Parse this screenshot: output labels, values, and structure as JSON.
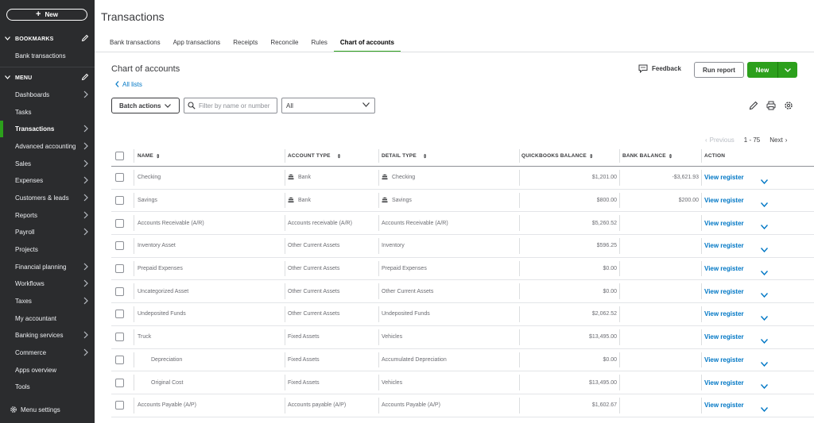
{
  "sidebar": {
    "new_label": "New",
    "bookmarks_label": "BOOKMARKS",
    "bookmark_items": [
      "Bank transactions"
    ],
    "menu_label": "MENU",
    "items": [
      {
        "label": "Dashboards",
        "arrow": true
      },
      {
        "label": "Tasks",
        "arrow": false
      },
      {
        "label": "Transactions",
        "arrow": true,
        "active": true
      },
      {
        "label": "Advanced accounting",
        "arrow": true
      },
      {
        "label": "Sales",
        "arrow": true
      },
      {
        "label": "Expenses",
        "arrow": true
      },
      {
        "label": "Customers & leads",
        "arrow": true
      },
      {
        "label": "Reports",
        "arrow": true
      },
      {
        "label": "Payroll",
        "arrow": true
      },
      {
        "label": "Projects",
        "arrow": false
      },
      {
        "label": "Financial planning",
        "arrow": true
      },
      {
        "label": "Workflows",
        "arrow": true
      },
      {
        "label": "Taxes",
        "arrow": true
      },
      {
        "label": "My accountant",
        "arrow": false
      },
      {
        "label": "Banking services",
        "arrow": true
      },
      {
        "label": "Commerce",
        "arrow": true
      },
      {
        "label": "Apps overview",
        "arrow": false
      },
      {
        "label": "Tools",
        "arrow": false
      }
    ],
    "settings_label": "Menu settings"
  },
  "header": {
    "title": "Transactions",
    "tabs": [
      "Bank transactions",
      "App transactions",
      "Receipts",
      "Reconcile",
      "Rules",
      "Chart of accounts"
    ],
    "active_tab": "Chart of accounts"
  },
  "content": {
    "title": "Chart of accounts",
    "back_link": "All lists",
    "feedback_label": "Feedback",
    "run_report_label": "Run report",
    "new_label": "New",
    "batch_actions_label": "Batch actions",
    "search_placeholder": "Filter by name or number",
    "filter_value": "All",
    "pager": {
      "previous": "Previous",
      "range": "1 - 75",
      "next": "Next"
    }
  },
  "colors": {
    "accent": "#2ca01c",
    "link": "#0077c5",
    "sidebar_bg": "#2b2c2e"
  },
  "table": {
    "headers": {
      "name": "NAME",
      "account_type": "ACCOUNT TYPE",
      "detail_type": "DETAIL TYPE",
      "qb_balance": "QUICKBOOKS BALANCE",
      "bank_balance": "BANK BALANCE",
      "action": "ACTION"
    },
    "action_label": "View register",
    "rows": [
      {
        "name": "Checking",
        "account_type": "Bank",
        "detail_type": "Checking",
        "qb_balance": "$1,201.00",
        "bank_balance": "-$3,621.93",
        "bank_icon": true,
        "indent": false
      },
      {
        "name": "Savings",
        "account_type": "Bank",
        "detail_type": "Savings",
        "qb_balance": "$800.00",
        "bank_balance": "$200.00",
        "bank_icon": true,
        "indent": false
      },
      {
        "name": "Accounts Receivable (A/R)",
        "account_type": "Accounts receivable (A/R)",
        "detail_type": "Accounts Receivable (A/R)",
        "qb_balance": "$5,260.52",
        "bank_balance": "",
        "bank_icon": false,
        "indent": false
      },
      {
        "name": "Inventory Asset",
        "account_type": "Other Current Assets",
        "detail_type": "Inventory",
        "qb_balance": "$596.25",
        "bank_balance": "",
        "bank_icon": false,
        "indent": false
      },
      {
        "name": "Prepaid Expenses",
        "account_type": "Other Current Assets",
        "detail_type": "Prepaid Expenses",
        "qb_balance": "$0.00",
        "bank_balance": "",
        "bank_icon": false,
        "indent": false
      },
      {
        "name": "Uncategorized Asset",
        "account_type": "Other Current Assets",
        "detail_type": "Other Current Assets",
        "qb_balance": "$0.00",
        "bank_balance": "",
        "bank_icon": false,
        "indent": false
      },
      {
        "name": "Undeposited Funds",
        "account_type": "Other Current Assets",
        "detail_type": "Undeposited Funds",
        "qb_balance": "$2,062.52",
        "bank_balance": "",
        "bank_icon": false,
        "indent": false
      },
      {
        "name": "Truck",
        "account_type": "Fixed Assets",
        "detail_type": "Vehicles",
        "qb_balance": "$13,495.00",
        "bank_balance": "",
        "bank_icon": false,
        "indent": false
      },
      {
        "name": "Depreciation",
        "account_type": "Fixed Assets",
        "detail_type": "Accumulated Depreciation",
        "qb_balance": "$0.00",
        "bank_balance": "",
        "bank_icon": false,
        "indent": true
      },
      {
        "name": "Original Cost",
        "account_type": "Fixed Assets",
        "detail_type": "Vehicles",
        "qb_balance": "$13,495.00",
        "bank_balance": "",
        "bank_icon": false,
        "indent": true
      },
      {
        "name": "Accounts Payable (A/P)",
        "account_type": "Accounts payable (A/P)",
        "detail_type": "Accounts Payable (A/P)",
        "qb_balance": "$1,602.67",
        "bank_balance": "",
        "bank_icon": false,
        "indent": false
      }
    ]
  }
}
